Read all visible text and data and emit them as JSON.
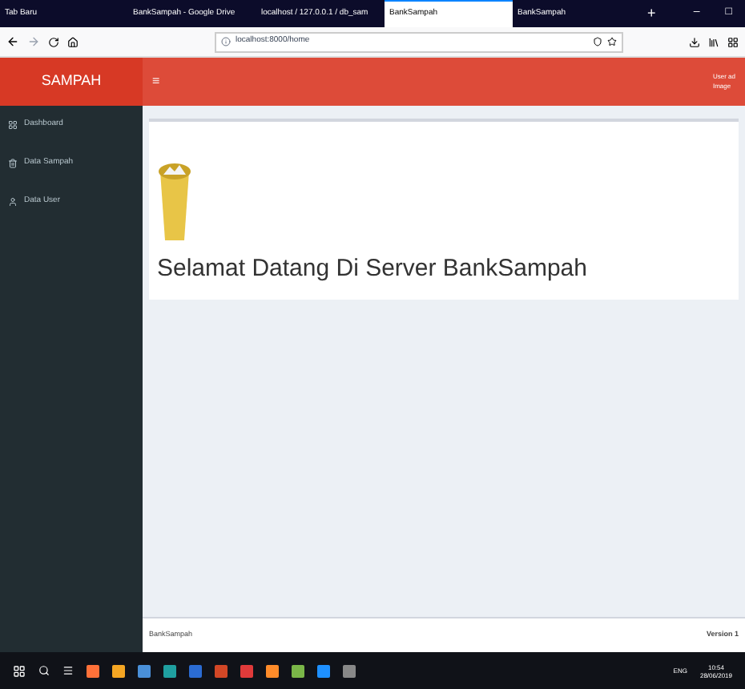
{
  "browser": {
    "tabs": [
      {
        "label": "Tab Baru",
        "selected": false
      },
      {
        "label": "BankSampah - Google Drive",
        "selected": false
      },
      {
        "label": "localhost / 127.0.0.1 / db_sam",
        "selected": false
      },
      {
        "label": "BankSampah",
        "selected": true
      },
      {
        "label": "BankSampah",
        "selected": false
      }
    ],
    "new_tab": "+",
    "minimize": "–",
    "restore": "□",
    "url": "localhost:8000/home"
  },
  "header": {
    "brand": "SAMPAH",
    "menu_toggle": "≡",
    "user_lines": [
      "User ad",
      "Image"
    ]
  },
  "sidebar": {
    "items": [
      {
        "label": "Dashboard",
        "selected": false
      },
      {
        "label": "Data Sampah",
        "selected": false
      },
      {
        "label": "Data User",
        "selected": false
      }
    ]
  },
  "main": {
    "welcome": "Selamat Datang Di Server BankSampah"
  },
  "footer": {
    "left": "BankSampah",
    "right": "Version 1"
  },
  "taskbar": {
    "language": "ENG",
    "time": "10:54",
    "date": "28/06/2019"
  }
}
